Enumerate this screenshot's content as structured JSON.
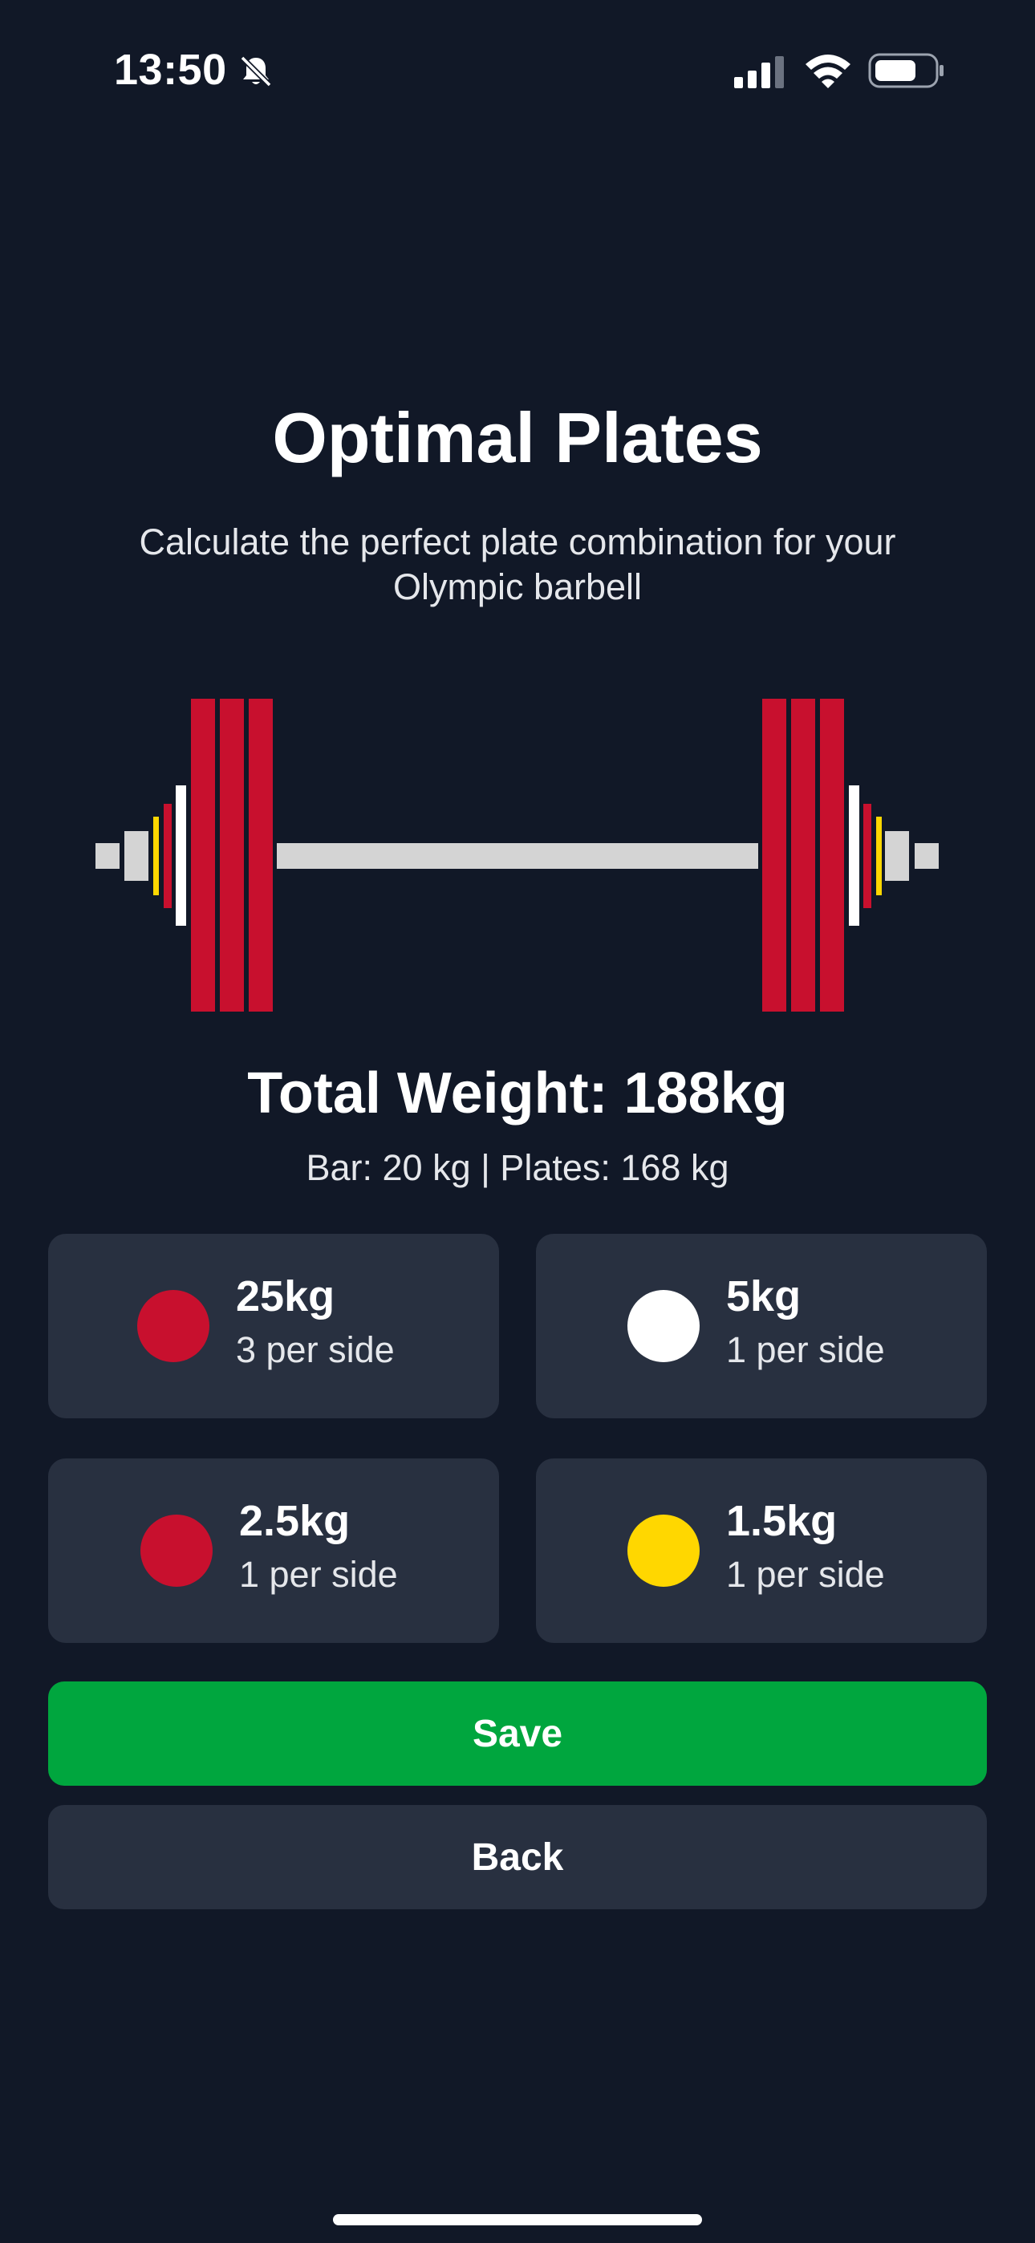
{
  "status_bar": {
    "time": "13:50",
    "icons": [
      "bell-slash-icon",
      "signal-icon",
      "wifi-icon",
      "battery-icon"
    ]
  },
  "title": "Optimal Plates",
  "subtitle": "Calculate the perfect plate combination for your Olympic barbell",
  "barbell": {
    "plates_per_side": [
      {
        "weight": "25kg",
        "count": 3,
        "color": "#c8102e"
      },
      {
        "weight": "5kg",
        "count": 1,
        "color": "#ffffff"
      },
      {
        "weight": "2.5kg",
        "count": 1,
        "color": "#c8102e"
      },
      {
        "weight": "1.5kg",
        "count": 1,
        "color": "#ffd700"
      }
    ],
    "bar_color": "#d4d4d4"
  },
  "summary": {
    "total": "Total Weight: 188kg",
    "breakdown": "Bar: 20 kg | Plates: 168 kg"
  },
  "plates": [
    {
      "weight": "25kg",
      "count": "3 per side",
      "color": "#c8102e"
    },
    {
      "weight": "5kg",
      "count": "1 per side",
      "color": "#ffffff"
    },
    {
      "weight": "2.5kg",
      "count": "1 per side",
      "color": "#c8102e"
    },
    {
      "weight": "1.5kg",
      "count": "1 per side",
      "color": "#ffd700"
    }
  ],
  "buttons": {
    "save": "Save",
    "back": "Back"
  },
  "colors": {
    "background": "#111827",
    "card": "#283040",
    "save": "#00a63e"
  }
}
